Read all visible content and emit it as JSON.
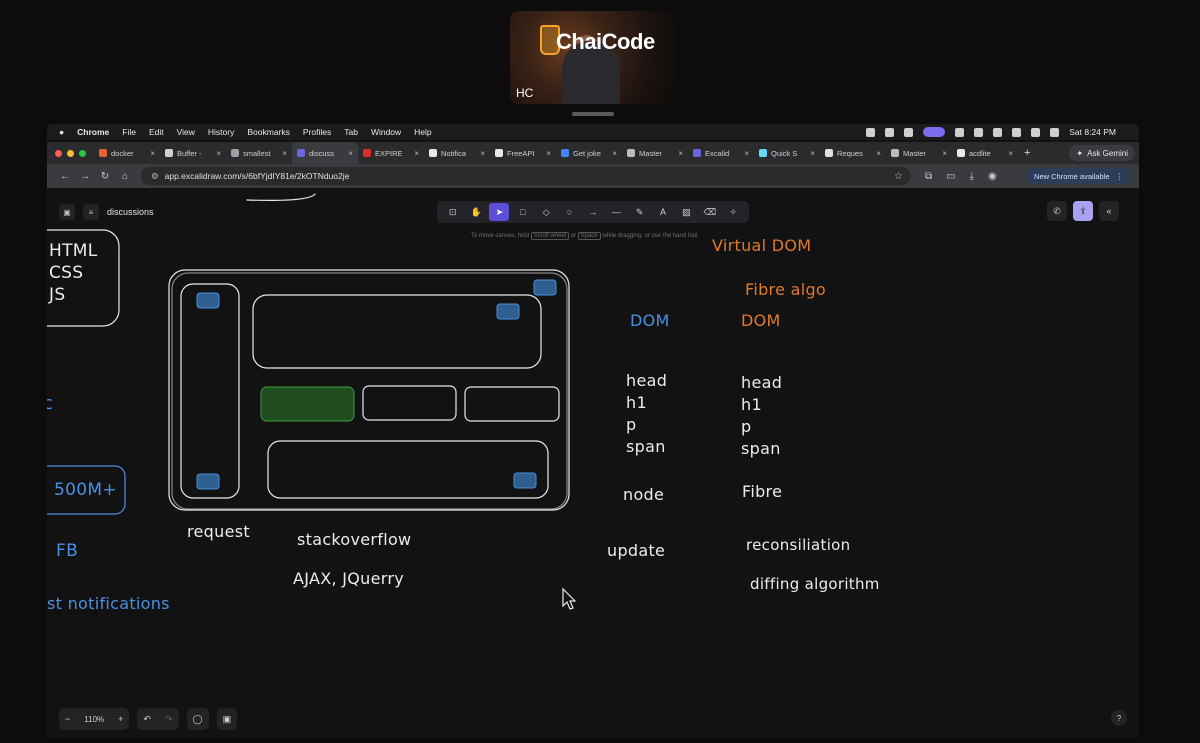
{
  "webcam": {
    "brand": "ChaiCode",
    "initials": "HC"
  },
  "menubar": {
    "app": "Chrome",
    "items": [
      "File",
      "Edit",
      "View",
      "History",
      "Bookmarks",
      "Profiles",
      "Tab",
      "Window",
      "Help"
    ],
    "clock": "Sat 8:24 PM"
  },
  "tabs": [
    {
      "title": "docker",
      "color": "#e8632b"
    },
    {
      "title": "Buffer -",
      "color": "#cfcfcf"
    },
    {
      "title": "smallest",
      "color": "#9aa0a6"
    },
    {
      "title": "discuss",
      "color": "#6965db",
      "active": true
    },
    {
      "title": "EXPIRE",
      "color": "#d93025"
    },
    {
      "title": "Notifica",
      "color": "#e8e8e8"
    },
    {
      "title": "FreeAPI",
      "color": "#e8e8e8"
    },
    {
      "title": "Get joke",
      "color": "#4285f4"
    },
    {
      "title": "Master",
      "color": "#bbbbbb"
    },
    {
      "title": "Excalid",
      "color": "#6965db"
    },
    {
      "title": "Quick S",
      "color": "#61dafb"
    },
    {
      "title": "Reques",
      "color": "#e0e0e0"
    },
    {
      "title": "Master",
      "color": "#bbbbbb"
    },
    {
      "title": "acdlite",
      "color": "#e8e8e8"
    }
  ],
  "tabbar": {
    "new_tab": "+",
    "gemini": "Ask Gemini"
  },
  "addressbar": {
    "url": "app.excalidraw.com/s/6bfYjdIY81e/2kOTNduo2je",
    "update": "New Chrome available"
  },
  "excalidraw": {
    "breadcrumb": "discussions",
    "hint_before": "To move canvas, hold",
    "hint_key1": "Scroll wheel",
    "hint_mid": "or",
    "hint_key2": "Space",
    "hint_after": "while dragging, or use the hand tool",
    "zoom": "110%"
  },
  "sketch": {
    "left_box": [
      "HTML",
      "CSS",
      "JS"
    ],
    "users": "500M+",
    "fb": "FB",
    "notifications": "st notifications",
    "request": "request",
    "stackoverflow": "stackoverflow",
    "ajax": "AJAX, JQuerry",
    "virtual_dom": "Virtual DOM",
    "fibre_algo": "Fibre algo",
    "dom_left": "DOM",
    "dom_right": "DOM",
    "tree_left": [
      "head",
      "h1",
      "p",
      "span"
    ],
    "tree_right": [
      "head",
      "h1",
      "p",
      "span"
    ],
    "node": "node",
    "fibre": "Fibre",
    "update": "update",
    "reconsiliation": "reconsiliation",
    "diffing": "diffing algorithm"
  },
  "colors": {
    "accent": "#6965db",
    "sketch_blue": "#4a90e2",
    "sketch_orange": "#e0792a",
    "green_fill": "#1f4d1f"
  }
}
